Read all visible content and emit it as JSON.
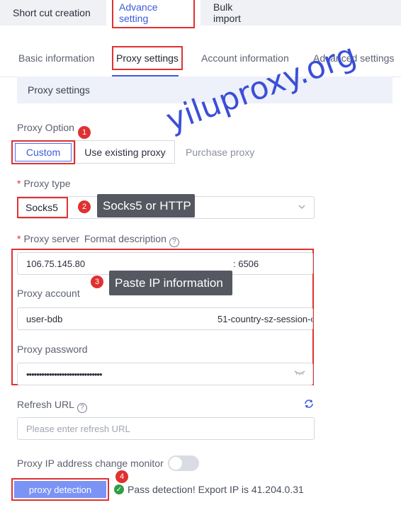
{
  "top_tabs": [
    "Short cut creation",
    "Advance setting",
    "Bulk import"
  ],
  "sub_tabs": [
    "Basic information",
    "Proxy settings",
    "Account information",
    "Advanced settings"
  ],
  "section_title": "Proxy settings",
  "proxy_option": {
    "label": "Proxy Option",
    "options": [
      "Custom",
      "Use existing proxy",
      "Purchase proxy"
    ]
  },
  "proxy_type": {
    "label": "Proxy type",
    "value": "Socks5"
  },
  "proxy_server": {
    "label": "Proxy server",
    "format_link": "Format description",
    "ip": "106.75.145.80",
    "port": ": 6506"
  },
  "proxy_account": {
    "label": "Proxy account",
    "value_left": "user-bdb",
    "value_right": "51-country-sz-session-c"
  },
  "proxy_password": {
    "label": "Proxy password",
    "value": "••••••••••••••••••••••••••••••"
  },
  "refresh_url": {
    "label": "Refresh URL",
    "placeholder": "Please enter refresh URL"
  },
  "ip_monitor": {
    "label": "Proxy IP address change monitor"
  },
  "detection": {
    "button": "proxy detection",
    "result": "Pass detection! Export IP is 41.204.0.31"
  },
  "annotations": {
    "badges": [
      "1",
      "2",
      "3",
      "4"
    ],
    "tooltip_type": "Socks5 or HTTP",
    "tooltip_paste": "Paste IP information"
  },
  "watermark": "yiluproxy.org",
  "icons": {
    "help": "question-circle-icon",
    "refresh": "refresh-icon",
    "eye": "eye-closed-icon",
    "chevron": "chevron-down-icon",
    "check": "check-circle-icon"
  },
  "colors": {
    "accent": "#3b5bdb",
    "highlight": "#e03131",
    "button": "#7b93f5",
    "success": "#2f9e44"
  }
}
